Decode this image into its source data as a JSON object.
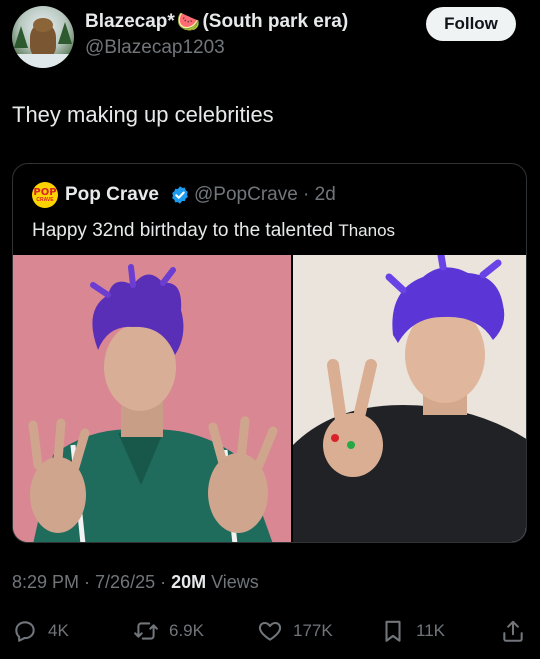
{
  "author": {
    "display_name": "Blazecap*",
    "emoji": "🍉",
    "name_suffix": "(South park era)",
    "handle": "@Blazecap1203",
    "avatar_icon": "avatar-icon"
  },
  "follow_label": "Follow",
  "tweet_text": "They making up celebrities",
  "quote": {
    "logo_top": "POP",
    "logo_bottom": "CRAVE",
    "name": "Pop Crave",
    "handle_time": "@PopCrave · 2d",
    "text_main": "Happy 32nd birthday to the talented ",
    "text_tail": "Thanos"
  },
  "meta": {
    "time_date": "8:29 PM · 7/26/25 · ",
    "views_count": "20M",
    "views_label": " Views"
  },
  "actions": {
    "replies": "4K",
    "reposts": "6.9K",
    "likes": "177K",
    "bookmarks": "11K"
  },
  "colors": {
    "background": "#000000",
    "muted": "#71767b",
    "text": "#e7e9ea",
    "verified": "#1d9bf0"
  }
}
